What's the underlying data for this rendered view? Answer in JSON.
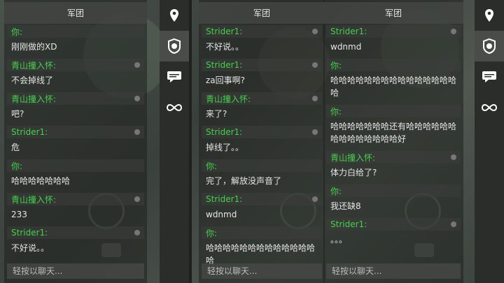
{
  "panel_title": "军团",
  "input_placeholder": "轻按以聊天...",
  "icons": {
    "location": "location-pin-icon",
    "clan": "clan-emblem-icon",
    "chat": "chat-bubble-icon",
    "infinity": "infinity-icon"
  },
  "colors": {
    "name_green": "#44d14a",
    "text_white": "#e6e6e6"
  },
  "left_panel": {
    "messages": [
      {
        "name": "你:",
        "text": "刚刚做的XD"
      },
      {
        "name": "青山撞入怀:",
        "text": "不会掉线了"
      },
      {
        "name": "青山撞入怀:",
        "text": "吧?"
      },
      {
        "name": "Strider1:",
        "text": "危"
      },
      {
        "name": "你:",
        "text": "哈哈哈哈哈哈哈"
      },
      {
        "name": "青山撞入怀:",
        "text": "233"
      },
      {
        "name": "Strider1:",
        "text": "不好说。。"
      }
    ]
  },
  "middle_panel": {
    "messages": [
      {
        "name": "Strider1:",
        "text": "不好说。。"
      },
      {
        "name": "Strider1:",
        "text": "za回事啊?"
      },
      {
        "name": "青山撞入怀:",
        "text": "来了?"
      },
      {
        "name": "Strider1:",
        "text": "掉线了。。"
      },
      {
        "name": "你:",
        "text": "完了，解放没声音了"
      },
      {
        "name": "Strider1:",
        "text": "wdnmd"
      },
      {
        "name": "你:",
        "text": "哈哈哈哈哈哈哈哈哈哈哈哈哈哈"
      }
    ]
  },
  "right_panel": {
    "messages": [
      {
        "name": "Strider1:",
        "text": "wdnmd"
      },
      {
        "name": "你:",
        "text": "哈哈哈哈哈哈哈哈哈哈哈哈哈哈哈哈"
      },
      {
        "name": "你:",
        "text": "哈哈哈哈哈哈哈还有哈哈哈哈哈哈哈哈哈哈哈哈哈哈好"
      },
      {
        "name": "青山撞入怀:",
        "text": "体力白给了?"
      },
      {
        "name": "你:",
        "text": "我还缺8"
      },
      {
        "name": "Strider1:",
        "text": "。。。"
      }
    ]
  }
}
